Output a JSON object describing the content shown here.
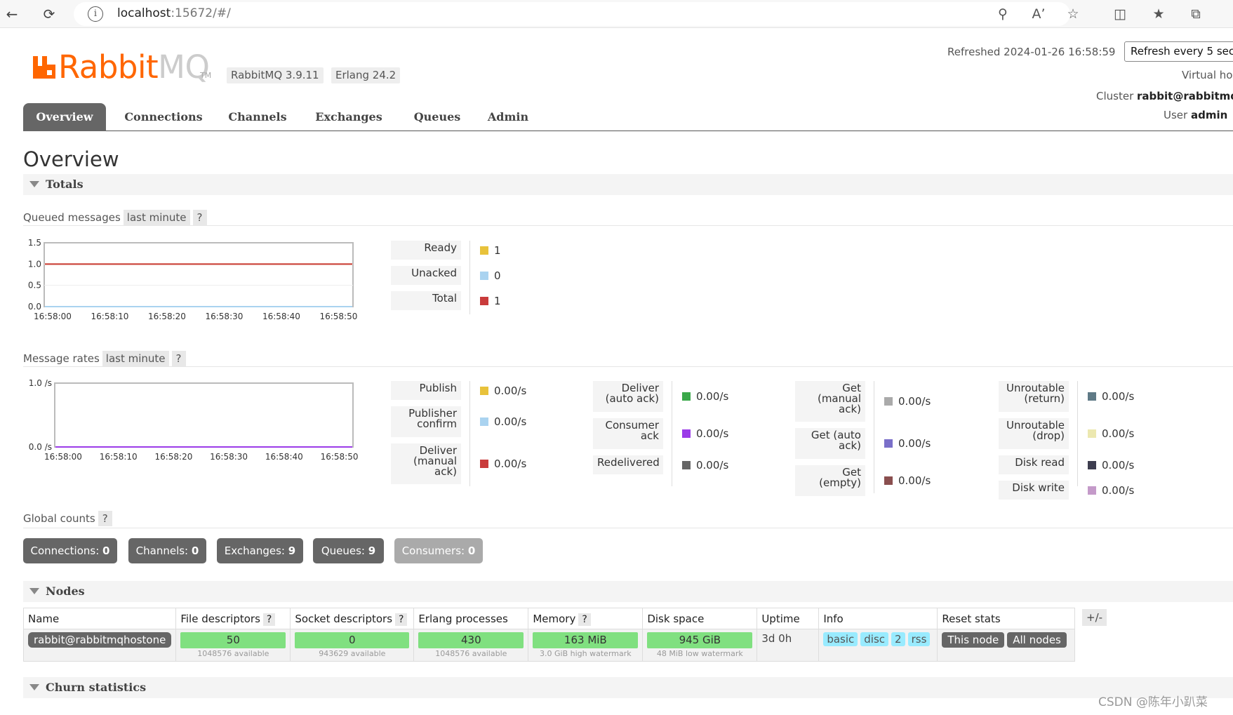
{
  "browser": {
    "url_host": "localhost",
    "url_rest": ":15672/#/"
  },
  "header": {
    "logo_rabbit": "Rabbit",
    "logo_mq": "MQ",
    "logo_tm": "TM",
    "rabbitmq_version": "RabbitMQ 3.9.11",
    "erlang_version": "Erlang 24.2",
    "refreshed_label": "Refreshed 2024-01-26 16:58:59",
    "refresh_select": "Refresh every 5 sec",
    "virtual_host_label": "Virtual ho",
    "cluster_label": "Cluster",
    "cluster_value": "rabbit@rabbitmq",
    "user_label": "User",
    "user_value": "admin"
  },
  "tabs": [
    {
      "label": "Overview",
      "active": true
    },
    {
      "label": "Connections"
    },
    {
      "label": "Channels"
    },
    {
      "label": "Exchanges"
    },
    {
      "label": "Queues"
    },
    {
      "label": "Admin"
    }
  ],
  "page_title": "Overview",
  "sections": {
    "totals": "Totals",
    "nodes": "Nodes",
    "churn": "Churn statistics"
  },
  "queued": {
    "title": "Queued messages",
    "range": "last minute",
    "help": "?",
    "legend": [
      {
        "label": "Ready",
        "value": "1",
        "color": "#e8c23b"
      },
      {
        "label": "Unacked",
        "value": "0",
        "color": "#aad3f0"
      },
      {
        "label": "Total",
        "value": "1",
        "color": "#c93b3b"
      }
    ]
  },
  "rates": {
    "title": "Message rates",
    "range": "last minute",
    "help": "?",
    "col1": [
      {
        "label": "Publish",
        "value": "0.00/s",
        "color": "#e8c23b"
      },
      {
        "label": "Publisher confirm",
        "value": "0.00/s",
        "color": "#aad3f0"
      },
      {
        "label": "Deliver (manual ack)",
        "value": "0.00/s",
        "color": "#c93b3b"
      }
    ],
    "col2": [
      {
        "label": "Deliver (auto ack)",
        "value": "0.00/s",
        "color": "#3aa84a"
      },
      {
        "label": "Consumer ack",
        "value": "0.00/s",
        "color": "#9b3be8"
      },
      {
        "label": "Redelivered",
        "value": "0.00/s",
        "color": "#666666"
      }
    ],
    "col3": [
      {
        "label": "Get (manual ack)",
        "value": "0.00/s",
        "color": "#aaaaaa"
      },
      {
        "label": "Get (auto ack)",
        "value": "0.00/s",
        "color": "#7a6fc9"
      },
      {
        "label": "Get (empty)",
        "value": "0.00/s",
        "color": "#8a4f4f"
      }
    ],
    "col4": [
      {
        "label": "Unroutable (return)",
        "value": "0.00/s",
        "color": "#5f7a86"
      },
      {
        "label": "Unroutable (drop)",
        "value": "0.00/s",
        "color": "#ece8b0"
      },
      {
        "label": "Disk read",
        "value": "0.00/s",
        "color": "#3d3d4f"
      },
      {
        "label": "Disk write",
        "value": "0.00/s",
        "color": "#c49ac9"
      }
    ]
  },
  "global_counts": {
    "title": "Global counts",
    "help": "?",
    "items": [
      {
        "label": "Connections:",
        "value": "0"
      },
      {
        "label": "Channels:",
        "value": "0"
      },
      {
        "label": "Exchanges:",
        "value": "9"
      },
      {
        "label": "Queues:",
        "value": "9"
      },
      {
        "label": "Consumers:",
        "value": "0"
      }
    ]
  },
  "nodes": {
    "headers": [
      "Name",
      "File descriptors",
      "Socket descriptors",
      "Erlang processes",
      "Memory",
      "Disk space",
      "Uptime",
      "Info",
      "Reset stats"
    ],
    "help": "?",
    "plus_minus": "+/-",
    "row": {
      "name": "rabbit@rabbitmqhostone",
      "fd": "50",
      "fd_sub": "1048576 available",
      "sd": "0",
      "sd_sub": "943629 available",
      "ep": "430",
      "ep_sub": "1048576 available",
      "mem": "163 MiB",
      "mem_sub": "3.0 GiB high watermark",
      "disk": "945 GiB",
      "disk_sub": "48 MiB low watermark",
      "uptime": "3d 0h",
      "info": [
        "basic",
        "disc",
        "2",
        "rss"
      ],
      "reset": [
        "This node",
        "All nodes"
      ]
    }
  },
  "watermark": "CSDN @陈年小趴菜",
  "chart_data": [
    {
      "type": "line",
      "title": "Queued messages",
      "x": [
        "16:58:00",
        "16:58:10",
        "16:58:20",
        "16:58:30",
        "16:58:40",
        "16:58:50"
      ],
      "ylim": [
        0,
        1.5
      ],
      "yticks": [
        "0.0",
        "0.5",
        "1.0",
        "1.5"
      ],
      "series": [
        {
          "name": "Ready",
          "values": [
            1,
            1,
            1,
            1,
            1,
            1
          ],
          "color": "#e8c23b"
        },
        {
          "name": "Unacked",
          "values": [
            0,
            0,
            0,
            0,
            0,
            0
          ],
          "color": "#aad3f0"
        },
        {
          "name": "Total",
          "values": [
            1,
            1,
            1,
            1,
            1,
            1
          ],
          "color": "#c93b3b"
        }
      ]
    },
    {
      "type": "line",
      "title": "Message rates",
      "x": [
        "16:58:00",
        "16:58:10",
        "16:58:20",
        "16:58:30",
        "16:58:40",
        "16:58:50"
      ],
      "ylim": [
        0,
        1
      ],
      "yticks": [
        "0.0 /s",
        "1.0 /s"
      ],
      "series": [
        {
          "name": "Publish",
          "values": [
            0,
            0,
            0,
            0,
            0,
            0
          ],
          "color": "#e8c23b"
        },
        {
          "name": "Deliver (manual ack)",
          "values": [
            0,
            0,
            0,
            0,
            0,
            0
          ],
          "color": "#c93b3b"
        },
        {
          "name": "Consumer ack",
          "values": [
            0,
            0,
            0,
            0,
            0,
            0
          ],
          "color": "#9b3be8"
        }
      ]
    }
  ]
}
